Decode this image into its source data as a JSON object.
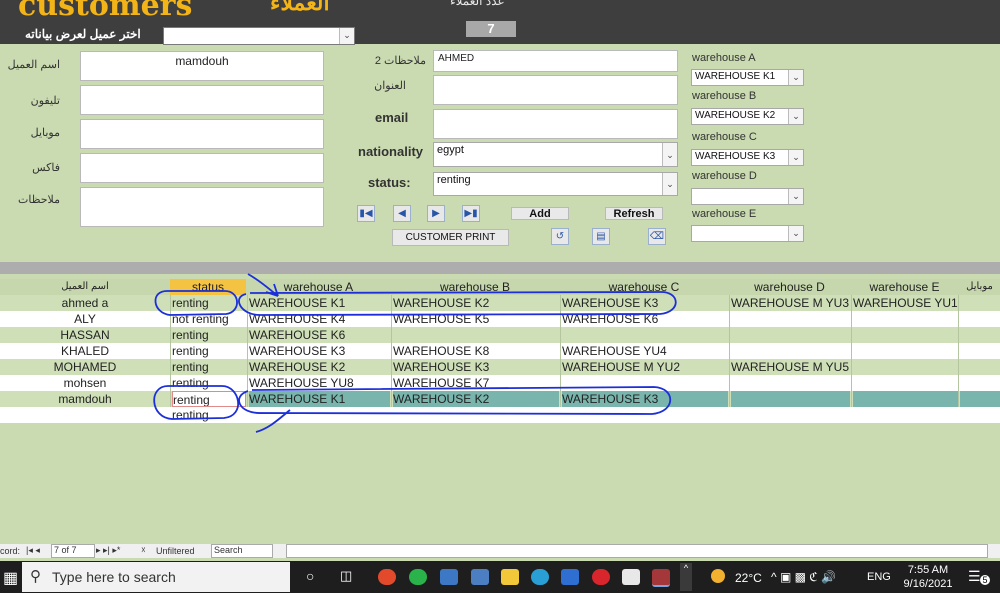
{
  "header": {
    "title": "customers",
    "title_ar": "العملاء",
    "top_text": "عدد العملاء",
    "record_count": "7",
    "choose_label": "اختر عميل لعرض بياناته",
    "choose_value": ""
  },
  "form": {
    "name_label": "اسم العميل",
    "name_value": "mamdouh",
    "phone_label": "تليفون",
    "phone_value": "",
    "mobile_label": "موبايل",
    "mobile_value": "",
    "fax_label": "فاكس",
    "fax_value": "",
    "notes_label": "ملاحظات",
    "notes_value": "",
    "notes2_label": "ملاحظات 2",
    "notes2_value": "AHMED",
    "address_label": "العنوان",
    "address_value": "",
    "email_label": "email",
    "email_value": "",
    "nationality_label": "nationality",
    "nationality_value": "egypt",
    "status_label": "status:",
    "status_value": "renting",
    "warehouses": [
      {
        "label": "warehouse A",
        "value": "WAREHOUSE K1"
      },
      {
        "label": "warehouse B",
        "value": "WAREHOUSE K2"
      },
      {
        "label": "warehouse C",
        "value": "WAREHOUSE K3"
      },
      {
        "label": "warehouse D",
        "value": ""
      },
      {
        "label": "warehouse E",
        "value": ""
      }
    ],
    "add_label": "Add",
    "refresh_label": "Refresh",
    "print_label": "CUSTOMER PRINT"
  },
  "grid": {
    "columns": [
      "اسم العميل",
      "status",
      "warehouse A",
      "warehouse B",
      "warehouse C",
      "warehouse D",
      "warehouse E",
      "موبايل"
    ],
    "rows": [
      [
        "ahmed a",
        "renting",
        "WAREHOUSE K1",
        "WAREHOUSE K2",
        "WAREHOUSE K3",
        "WAREHOUSE M YU3",
        "WAREHOUSE YU1"
      ],
      [
        "ALY",
        "not renting",
        "WAREHOUSE K4",
        "WAREHOUSE K5",
        "WAREHOUSE K6",
        "",
        ""
      ],
      [
        "HASSAN",
        "renting",
        "WAREHOUSE K6",
        "",
        "",
        "",
        ""
      ],
      [
        "KHALED",
        "renting",
        "WAREHOUSE K3",
        "WAREHOUSE K8",
        "WAREHOUSE YU4",
        "",
        ""
      ],
      [
        "MOHAMED",
        "renting",
        "WAREHOUSE K2",
        "WAREHOUSE K3",
        "WAREHOUSE M YU2",
        "WAREHOUSE M YU5",
        ""
      ],
      [
        "mohsen",
        "renting",
        "WAREHOUSE YU8",
        "WAREHOUSE K7",
        "",
        "",
        ""
      ],
      [
        "mamdouh",
        "renting",
        "WAREHOUSE K1",
        "WAREHOUSE K2",
        "WAREHOUSE K3",
        "",
        ""
      ]
    ],
    "new_row_status": "renting"
  },
  "record_nav": {
    "prefix": "cord:",
    "position": "7 of 7",
    "filter": "Unfiltered",
    "search": "Search"
  },
  "taskbar": {
    "search_placeholder": "Type here to search",
    "weather": "22°C",
    "lang": "ENG",
    "time": "7:55 AM",
    "date": "9/16/2021",
    "notif_count": "5"
  }
}
